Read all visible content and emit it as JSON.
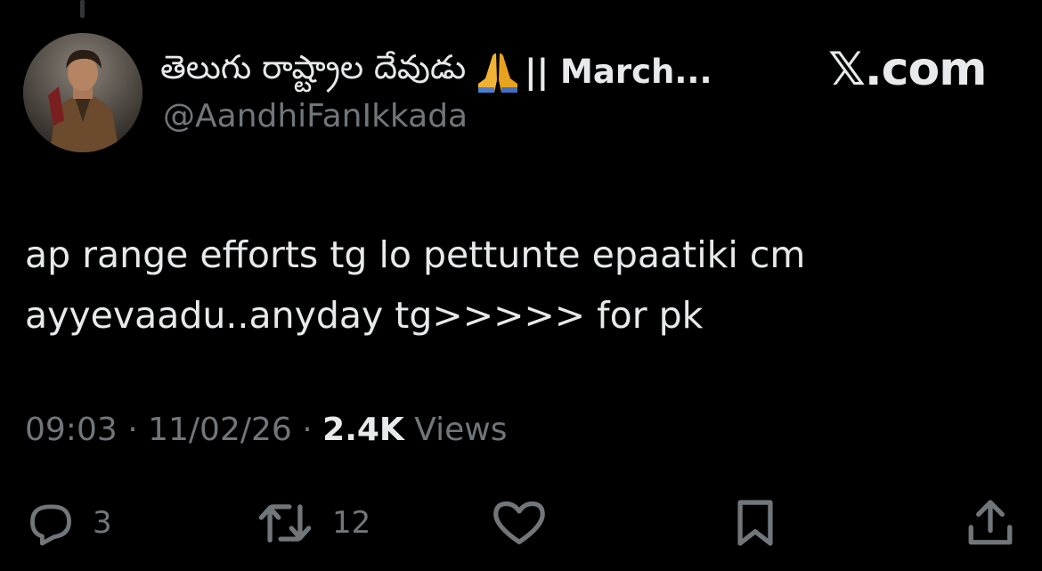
{
  "author": {
    "display_name_telugu": "తెలుగు రాష్ట్రాల దేవుడు",
    "display_name_rest": "|| March...",
    "handle": "@AandhiFanIkkada",
    "emoji": "folded-hands-emoji",
    "avatar": "avatar-photo"
  },
  "brand": {
    "label": "𝕏.com"
  },
  "tweet": {
    "text": "ap range efforts tg lo pettunte epaatiki cm\nayyevaadu..anyday tg>>>>> for pk",
    "time": "09:03",
    "date": "11/02/26",
    "separator": "·",
    "views_count": "2.4K",
    "views_label": "Views"
  },
  "actions": {
    "reply": {
      "icon": "reply-icon",
      "count": "3"
    },
    "retweet": {
      "icon": "retweet-icon",
      "count": "12"
    },
    "like": {
      "icon": "heart-icon"
    },
    "bookmark": {
      "icon": "bookmark-icon"
    },
    "share": {
      "icon": "share-icon"
    }
  },
  "colors": {
    "background": "#000000",
    "primary_text": "#e7e9ea",
    "secondary_text": "#71767b"
  }
}
